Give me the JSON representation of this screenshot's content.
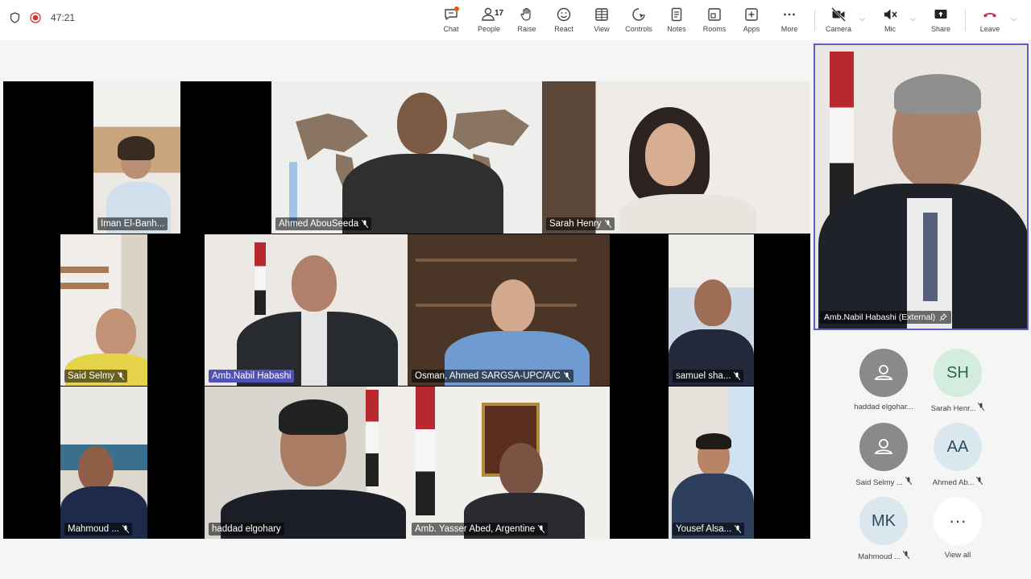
{
  "meeting": {
    "timer": "47:21"
  },
  "toolbar": {
    "chat": "Chat",
    "people": "People",
    "people_count": "17",
    "raise": "Raise",
    "react": "React",
    "view": "View",
    "controls": "Controls",
    "notes": "Notes",
    "rooms": "Rooms",
    "apps": "Apps",
    "more": "More",
    "camera": "Camera",
    "mic": "Mic",
    "share": "Share",
    "leave": "Leave"
  },
  "tiles": [
    {
      "name": "Iman El-Banh..."
    },
    {
      "name": "Ahmed AbouSeeda"
    },
    {
      "name": "Sarah Henry"
    },
    {
      "name": "Said Selmy"
    },
    {
      "name": "Amb.Nabil Habashi"
    },
    {
      "name": "Osman, Ahmed SARGSA-UPC/A/C"
    },
    {
      "name": "samuel sha..."
    },
    {
      "name": "Mahmoud ..."
    },
    {
      "name": "haddad elgohary"
    },
    {
      "name": "Amb. Yasser Abed, Argentine"
    },
    {
      "name": "Yousef Alsa..."
    }
  ],
  "spotlight": {
    "name": "Amb.Nabil Habashi (External)"
  },
  "roster": [
    {
      "initials": "",
      "name": "haddad elgohar..."
    },
    {
      "initials": "SH",
      "name": "Sarah Henr..."
    },
    {
      "initials": "",
      "name": "Said Selmy ..."
    },
    {
      "initials": "AA",
      "name": "Ahmed Ab..."
    },
    {
      "initials": "MK",
      "name": "Mahmoud ..."
    },
    {
      "initials": "···",
      "name": "View all"
    }
  ],
  "colors": {
    "accent": "#5b5fc7",
    "leave": "#c4314b",
    "recording": "#d13438"
  }
}
